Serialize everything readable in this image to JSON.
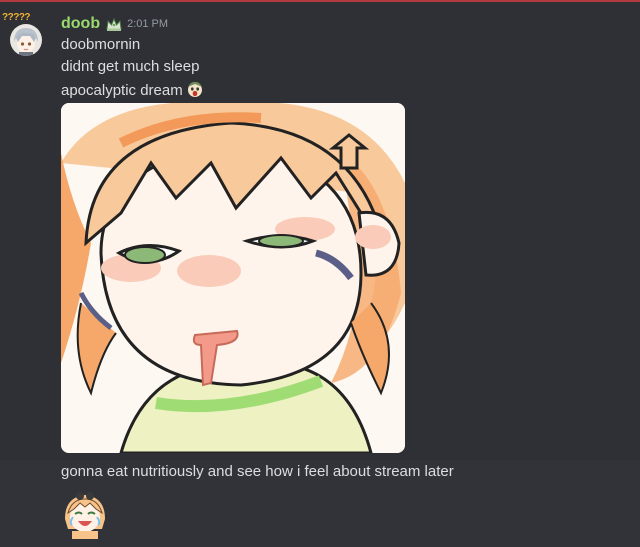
{
  "message": {
    "author": "doob",
    "badge_text": "?????",
    "timestamp": "2:01 PM",
    "lines": [
      "doobmornin",
      "didnt get much sleep",
      "apocalyptic dream"
    ],
    "after_image_line": "gonna eat nutritiously and see how i feel about stream later"
  },
  "icons": {
    "avatar": "user-avatar",
    "role_icon": "crown-icon",
    "inline_emoji": "screaming-face-emoji",
    "attachment": "drawing-attachment",
    "big_emoji": "crying-laugh-character-emoji"
  },
  "colors": {
    "background": "#313338",
    "username": "#9ad96e",
    "timestamp": "#949ba4",
    "text": "#dbdee1",
    "accent_line": "#b2393e"
  }
}
